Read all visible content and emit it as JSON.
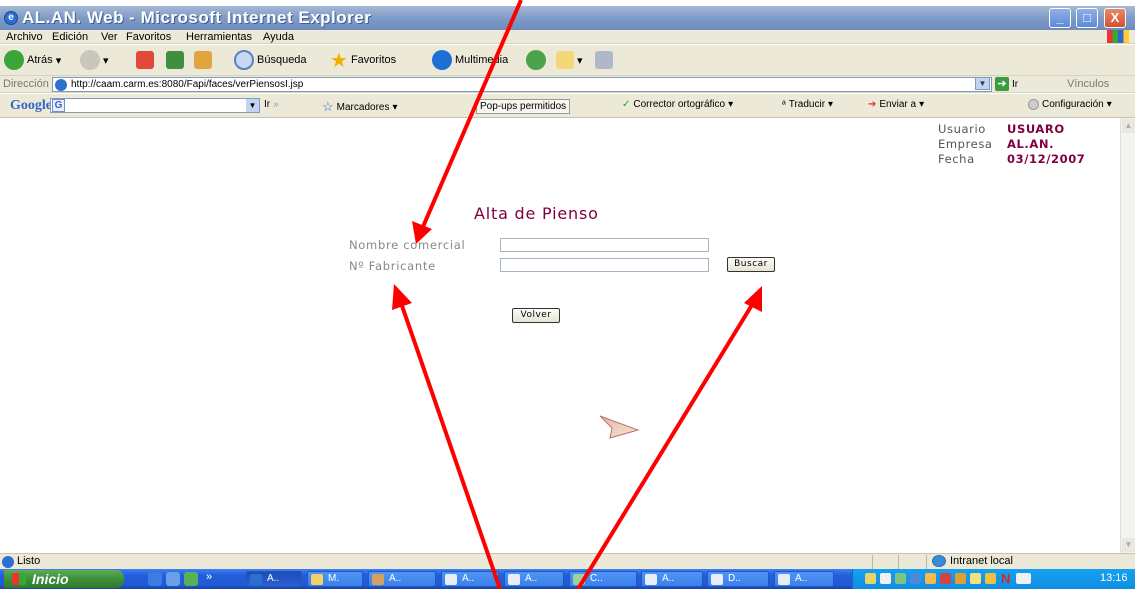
{
  "window": {
    "title": "AL.AN. Web - Microsoft Internet Explorer",
    "minimize": "_",
    "maximize": "□",
    "close": "X"
  },
  "menu": [
    "Archivo",
    "Edición",
    "Ver",
    "Favoritos",
    "Herramientas",
    "Ayuda"
  ],
  "toolbar": {
    "back": "Atrás",
    "search": "Búsqueda",
    "favorites": "Favoritos",
    "multimedia": "Multimedia"
  },
  "address": {
    "label": "Dirección",
    "url": "http://caam.carm.es:8080/Fapi/faces/verPiensosI.jsp",
    "go": "Ir",
    "links": "Vínculos"
  },
  "google": {
    "logo": "Google",
    "go": "Ir",
    "bookmarks": "Marcadores",
    "popups": "Pop-ups permitidos",
    "spell": "Corrector ortográfico",
    "translate": "Traducir",
    "send": "Enviar a",
    "settings": "Configuración"
  },
  "user": {
    "user_label": "Usuario",
    "user_value": "USUARO",
    "company_label": "Empresa",
    "company_value": "AL.AN.",
    "date_label": "Fecha",
    "date_value": "03/12/2007"
  },
  "form": {
    "title": "Alta de Pienso",
    "name_label": "Nombre comercial",
    "name_value": "",
    "maker_label": "Nº Fabricante",
    "maker_value": "",
    "search_button": "Buscar",
    "back_button": "Volver"
  },
  "status": {
    "text": "Listo",
    "zone": "Intranet local"
  },
  "taskbar": {
    "start": "Inicio",
    "buttons": [
      "A..",
      "M.",
      "A..",
      "A..",
      "A..",
      "C..",
      "A..",
      "D..",
      "A.."
    ],
    "clock": "13:16"
  },
  "colors": {
    "accent": "#800040",
    "annotation_arrow": "#ff0000"
  }
}
